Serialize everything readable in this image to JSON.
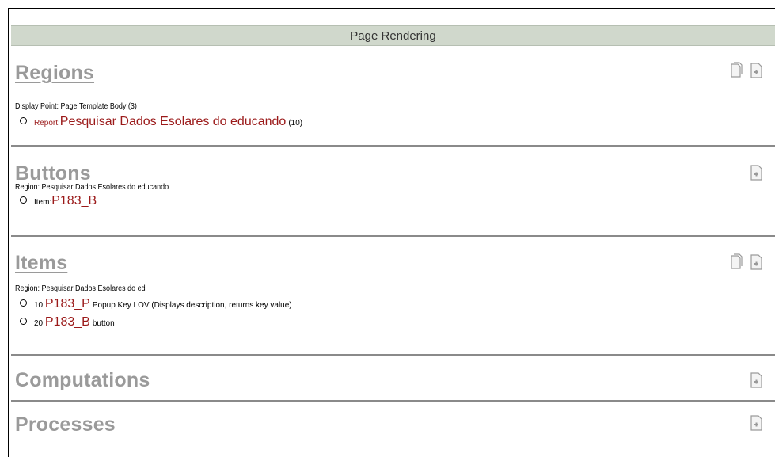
{
  "header": {
    "title": "Page Rendering"
  },
  "regions": {
    "title": "Regions",
    "display_point": "Display Point: Page Template Body (3)",
    "item": {
      "prefix": "Report",
      "colon": ": ",
      "name": "Pesquisar Dados Esolares do educando",
      "count": "(10)"
    }
  },
  "buttons": {
    "title": "Buttons",
    "region_line": "Region: Pesquisar Dados Esolares do educando",
    "item": {
      "prefix": "Item: ",
      "name": "P183_B"
    }
  },
  "items": {
    "title": "Items",
    "region_line": "Region: Pesquisar Dados Esolares do ed",
    "rows": [
      {
        "prefix": "10: ",
        "name": "P183_P",
        "desc": "Popup Key LOV (Displays description, returns key value)"
      },
      {
        "prefix": "20: ",
        "name": "P183_B",
        "desc": "button"
      }
    ]
  },
  "computations": {
    "title": "Computations"
  },
  "processes": {
    "title": "Processes"
  },
  "icons": {
    "copy": "copy-icon",
    "add": "add-icon"
  },
  "colors": {
    "header_bg": "#d0d8cc",
    "link_red": "#9b1a1a",
    "section_title_gray": "#9a9a9a"
  }
}
